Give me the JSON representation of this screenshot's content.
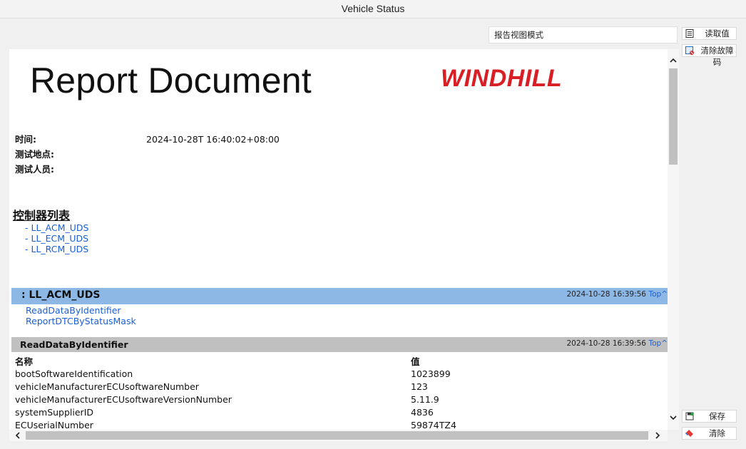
{
  "window": {
    "title": "Vehicle Status"
  },
  "toolbar": {
    "mode_value": "报告视图模式",
    "read_label": "读取值",
    "clear_dtc_label": "清除故障码",
    "save_label": "保存",
    "clear_label": "清除"
  },
  "report": {
    "title": "Report Document",
    "logo_text": "WINDHILL",
    "info": {
      "time_label": "时间:",
      "time_value": "2024-10-28T 16:40:02+08:00",
      "location_label": "测试地点:",
      "tester_label": "测试人员:"
    },
    "toc": {
      "title": "控制器列表",
      "items": [
        "- LL_ACM_UDS",
        "- LL_ECM_UDS",
        "- LL_RCM_UDS"
      ]
    },
    "ecu_section": {
      "name": ": LL_ACM_UDS",
      "timestamp": "2024-10-28 16:39:56",
      "top_link": "Top^",
      "services": [
        "ReadDataByIdentifier",
        "ReportDTCByStatusMask"
      ]
    },
    "service_section": {
      "name": "ReadDataByIdentifier",
      "timestamp": "2024-10-28 16:39:56",
      "top_link": "Top^",
      "columns": [
        "名称",
        "值"
      ],
      "rows": [
        [
          "bootSoftwareIdentification",
          "1023899"
        ],
        [
          "vehicleManufacturerECUsoftwareNumber",
          "123"
        ],
        [
          "vehicleManufacturerECUsoftwareVersionNumber",
          "5.11.9"
        ],
        [
          "systemSupplierID",
          "4836"
        ],
        [
          "ECUserialNumber",
          "59874TZ4"
        ]
      ]
    }
  },
  "icons": {
    "read": "document-list-icon",
    "clear_dtc": "image-clear-icon",
    "save": "save-icon",
    "clear": "eraser-icon"
  },
  "colors": {
    "ecu_bar": "#8db8e6",
    "service_bar": "#c0c0c0",
    "link": "#1a5fd6",
    "logo": "#d81f26"
  }
}
